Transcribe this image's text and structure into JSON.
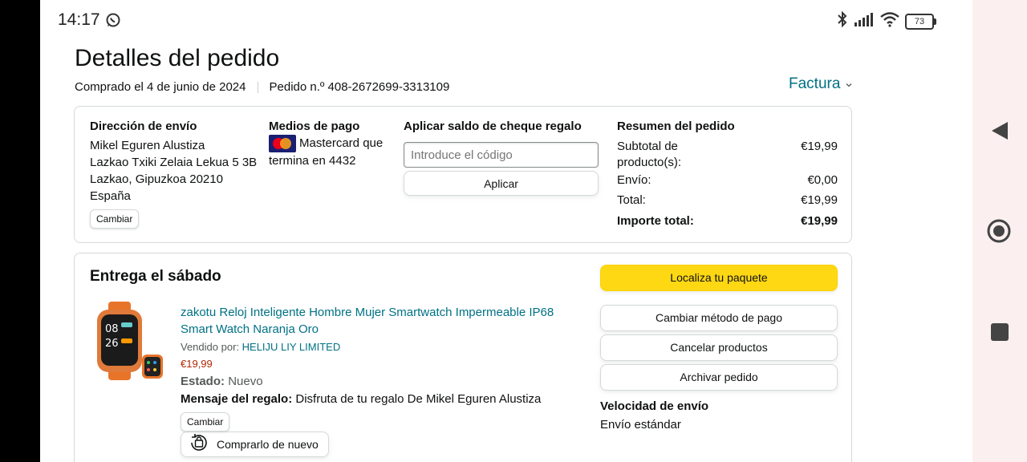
{
  "status_bar": {
    "time": "14:17",
    "battery": "73"
  },
  "header": {
    "title": "Detalles del pedido",
    "ordered": "Comprado el 4 de junio de 2024",
    "order_number": "Pedido n.º 408-2672699-3313109",
    "invoice": "Factura"
  },
  "info_card": {
    "shipping": {
      "label": "Dirección de envío",
      "lines": [
        "Mikel Eguren Alustiza",
        "Lazkao Txiki Zelaia Lekua 5 3B",
        "Lazkao, Gipuzkoa 20210",
        "España"
      ],
      "change": "Cambiar"
    },
    "payment": {
      "label": "Medios de pago",
      "line1": "Mastercard que",
      "line2": "termina en 4432"
    },
    "gift": {
      "label": "Aplicar saldo de cheque regalo",
      "placeholder": "Introduce el código",
      "apply": "Aplicar"
    },
    "summary": {
      "label": "Resumen del pedido",
      "subtotal_label_1": "Subtotal de",
      "subtotal_label_2": "producto(s):",
      "subtotal": "€19,99",
      "shipping_label": "Envío:",
      "shipping": "€0,00",
      "total_label": "Total:",
      "total": "€19,99",
      "grand_label": "Importe total:",
      "grand": "€19,99"
    }
  },
  "delivery": {
    "heading": "Entrega el sábado",
    "product": {
      "title_1": "zakotu Reloj Inteligente Hombre Mujer Smartwatch Impermeable IP68",
      "title_2": "Smart Watch Naranja Oro",
      "sold_by_label": "Vendido por:",
      "seller": "HELIJU LIY LIMITED",
      "price": "€19,99",
      "condition_label": "Estado:",
      "condition": "Nuevo",
      "gift_label": "Mensaje del regalo:",
      "gift_message": "Disfruta de tu regalo De Mikel Eguren Alustiza",
      "change": "Cambiar",
      "buy_again": "Comprarlo de nuevo"
    },
    "actions": {
      "track": "Localiza tu paquete",
      "change_payment": "Cambiar método de pago",
      "cancel": "Cancelar productos",
      "archive": "Archivar pedido"
    },
    "speed_label": "Velocidad de envío",
    "speed": "Envío estándar"
  },
  "colors": {
    "link": "#007185",
    "accent_yellow": "#ffd814",
    "price_red": "#b12704"
  }
}
